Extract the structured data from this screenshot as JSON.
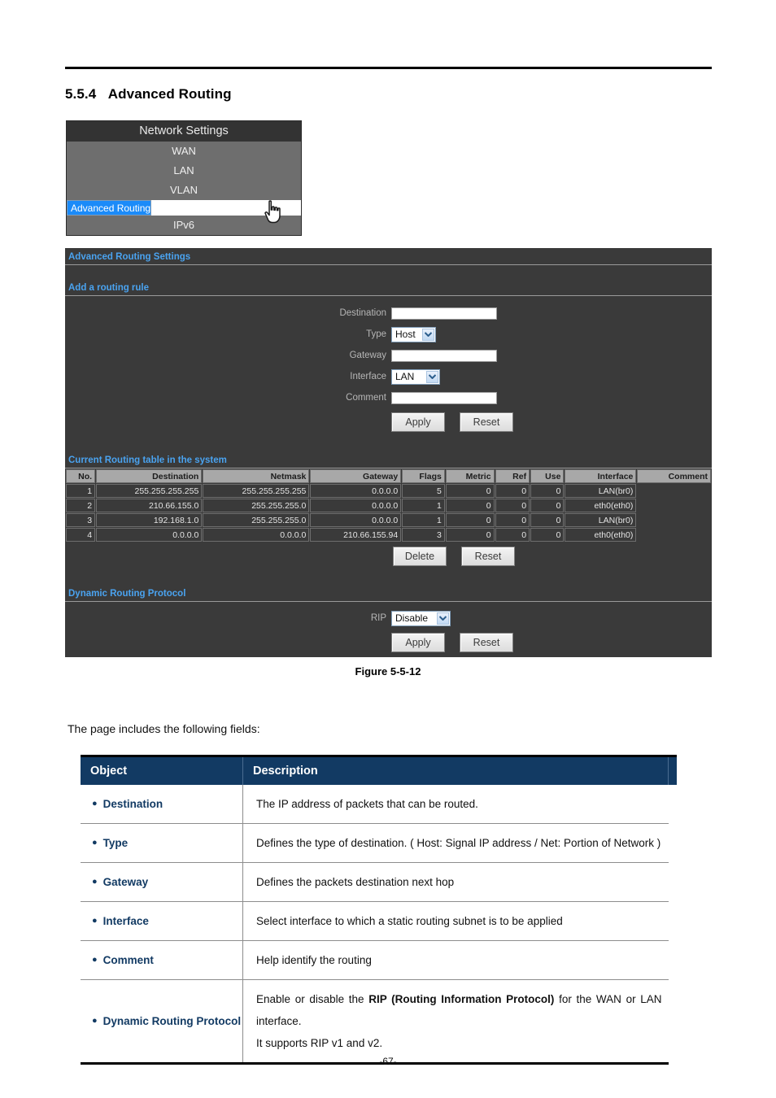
{
  "document": {
    "section_number": "5.5.4",
    "section_title": "Advanced Routing",
    "figure_caption": "Figure 5-5-12",
    "intro_text": "The page includes the following fields:",
    "page_number": "-67-"
  },
  "menu": {
    "title": "Network Settings",
    "items": [
      {
        "label": "WAN",
        "selected": false
      },
      {
        "label": "LAN",
        "selected": false
      },
      {
        "label": "VLAN",
        "selected": false
      },
      {
        "label": "Advanced Routing",
        "selected": true
      },
      {
        "label": "IPv6",
        "selected": false
      }
    ],
    "selected_color": "#1b8bf9",
    "header_color": "#333333",
    "item_color": "#6e6e6e"
  },
  "panel": {
    "title": "Advanced Routing Settings",
    "add_rule": {
      "title": "Add a routing rule",
      "fields": {
        "destination_label": "Destination",
        "destination_value": "",
        "type_label": "Type",
        "type_value": "Host",
        "gateway_label": "Gateway",
        "gateway_value": "",
        "interface_label": "Interface",
        "interface_value": "LAN",
        "comment_label": "Comment",
        "comment_value": ""
      },
      "apply_label": "Apply",
      "reset_label": "Reset"
    },
    "routing_table": {
      "title": "Current Routing table in the system",
      "columns": [
        "No.",
        "Destination",
        "Netmask",
        "Gateway",
        "Flags",
        "Metric",
        "Ref",
        "Use",
        "Interface",
        "Comment"
      ],
      "rows": [
        [
          "1",
          "255.255.255.255",
          "255.255.255.255",
          "0.0.0.0",
          "5",
          "0",
          "0",
          "0",
          "LAN(br0)",
          ""
        ],
        [
          "2",
          "210.66.155.0",
          "255.255.255.0",
          "0.0.0.0",
          "1",
          "0",
          "0",
          "0",
          "eth0(eth0)",
          ""
        ],
        [
          "3",
          "192.168.1.0",
          "255.255.255.0",
          "0.0.0.0",
          "1",
          "0",
          "0",
          "0",
          "LAN(br0)",
          ""
        ],
        [
          "4",
          "0.0.0.0",
          "0.0.0.0",
          "210.66.155.94",
          "3",
          "0",
          "0",
          "0",
          "eth0(eth0)",
          ""
        ]
      ],
      "delete_label": "Delete",
      "reset_label": "Reset"
    },
    "dynamic_routing": {
      "title": "Dynamic Routing Protocol",
      "rip_label": "RIP",
      "rip_value": "Disable",
      "apply_label": "Apply",
      "reset_label": "Reset"
    },
    "background_color": "#3a3a3a",
    "accent_color": "#4aa3f0"
  },
  "desc_table": {
    "header": {
      "object": "Object",
      "description": "Description"
    },
    "rows": [
      {
        "object": "Destination",
        "description": "The IP address of packets that can be routed."
      },
      {
        "object": "Type",
        "description": "Defines the type of destination. ( Host: Signal IP address / Net: Portion of Network )"
      },
      {
        "object": "Gateway",
        "description": "Defines the packets destination next hop"
      },
      {
        "object": "Interface",
        "description": "Select interface to which a static routing subnet is to be applied"
      },
      {
        "object": "Comment",
        "description": "Help identify the routing"
      },
      {
        "object": "Dynamic Routing Protocol",
        "description_part1": "Enable or disable the ",
        "description_bold": "RIP (Routing Information Protocol)",
        "description_part2": " for the WAN or LAN interface.",
        "description_line2": "It supports RIP v1 and v2."
      }
    ],
    "header_color": "#123a63"
  }
}
